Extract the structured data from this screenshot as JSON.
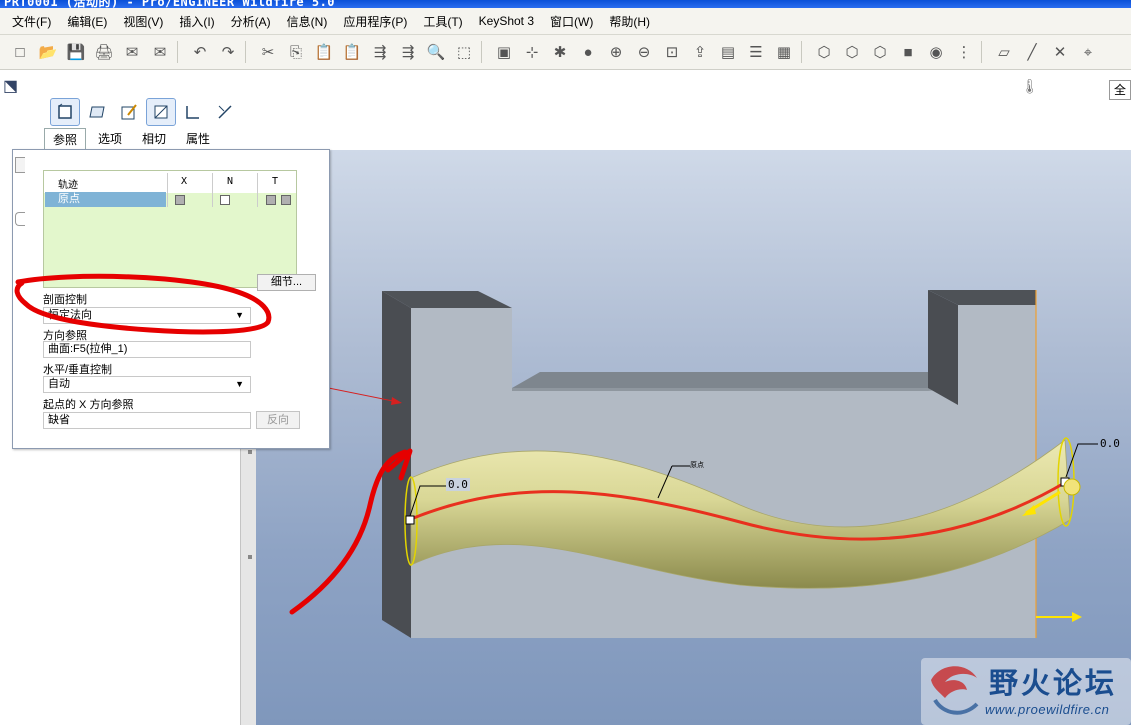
{
  "window": {
    "title": "PRT0001 (活动的) - Pro/ENGINEER Wildfire 5.0"
  },
  "menubar": {
    "items": [
      "文件(F)",
      "编辑(E)",
      "视图(V)",
      "插入(I)",
      "分析(A)",
      "信息(N)",
      "应用程序(P)",
      "工具(T)",
      "KeyShot 3",
      "窗口(W)",
      "帮助(H)"
    ]
  },
  "toolbar": {
    "icons": [
      "new-icon",
      "open-icon",
      "save-icon",
      "print-icon",
      "send-icon",
      "mail-icon",
      "sep",
      "undo-icon",
      "redo-icon",
      "sep",
      "cut-icon",
      "copy-icon",
      "paste-icon",
      "paste-special-icon",
      "regenerate-icon",
      "regenerate-manager-icon",
      "find-icon",
      "select-box-icon",
      "sep",
      "repaint-icon",
      "spin-center-icon",
      "orient-icon",
      "appearance-icon",
      "zoom-in-icon",
      "zoom-out-icon",
      "refit-icon",
      "view-manager-icon",
      "named-view-icon",
      "layers-icon",
      "model-setup-icon",
      "sep",
      "wireframe-icon",
      "hidden-line-icon",
      "no-hidden-icon",
      "shading-icon",
      "enhanced-realism-icon",
      "settings-icon",
      "sep",
      "datum-plane-icon",
      "datum-axis-icon",
      "datum-point-icon",
      "csys-icon"
    ]
  },
  "dashboard": {
    "tabs": [
      {
        "label": "参照",
        "active": true
      },
      {
        "label": "选项",
        "active": false
      },
      {
        "label": "相切",
        "active": false
      },
      {
        "label": "属性",
        "active": false
      }
    ],
    "icons": [
      "solid-icon",
      "surface-icon",
      "sketch-icon",
      "cut-material-icon",
      "thin-icon",
      "flip-icon"
    ],
    "full_button": "全"
  },
  "references_panel": {
    "columns": [
      "轨迹",
      "X",
      "N",
      "T"
    ],
    "rows": [
      {
        "name": "原点",
        "x": true,
        "n": false,
        "t": true
      }
    ],
    "detail_button": "细节...",
    "section_control_label": "剖面控制",
    "section_control_value": "恒定法向",
    "direction_ref_label": "方向参照",
    "direction_ref_value": "曲面:F5(拉伸_1)",
    "hv_control_label": "水平/垂直控制",
    "hv_control_value": "自动",
    "x_dir_ref_label": "起点的 X 方向参照",
    "x_dir_ref_value": "缺省",
    "flip_button": "反向"
  },
  "viewport": {
    "dim_left": "0.0",
    "dim_right": "0.0",
    "curve_label": "原点",
    "accent_color": "#e8301e",
    "sweep_color": "#c8c686"
  },
  "watermark": {
    "title": "野火论坛",
    "url": "www.proewildfire.cn"
  }
}
